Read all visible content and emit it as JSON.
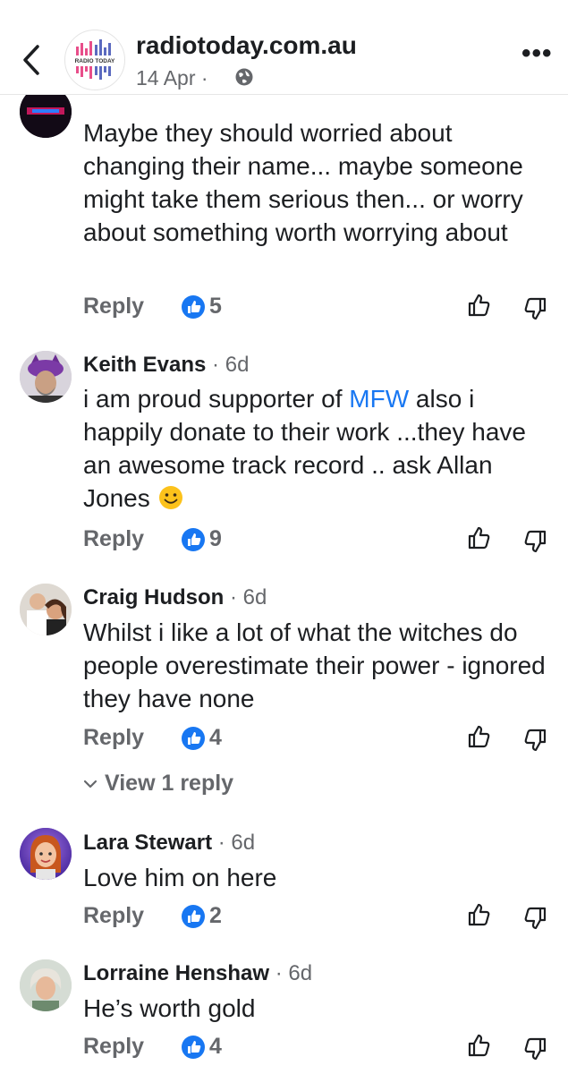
{
  "header": {
    "site_name": "radiotoday.com.au",
    "date": "14 Apr ·",
    "logo_text": "RADIO TODAY",
    "back_icon": "chevron-left-icon",
    "globe_icon": "globe-icon",
    "more_icon": "more-icon"
  },
  "comments": [
    {
      "text": "Maybe they should worried about changing their name... maybe someone might take them serious then... or worry about something worth worrying about",
      "reply_label": "Reply",
      "likes": "5"
    },
    {
      "name": "Keith Evans",
      "time": " · 6d",
      "text_before": "i am proud supporter of ",
      "text_link": "MFW",
      "text_after": " also i happily donate to their work ...they have an awesome track record .. ask Allan Jones ",
      "reply_label": "Reply",
      "likes": "9"
    },
    {
      "name": "Craig Hudson",
      "time": " · 6d",
      "text": "Whilst i like a lot of what the witches do people overestimate their power - ignored they have none",
      "reply_label": "Reply",
      "likes": "4",
      "view_replies": "View 1 reply"
    },
    {
      "name": "Lara Stewart",
      "time": " · 6d",
      "text": "Love him on here",
      "reply_label": "Reply",
      "likes": "2"
    },
    {
      "name": "Lorraine Henshaw",
      "time": " · 6d",
      "text": "He’s worth gold",
      "reply_label": "Reply",
      "likes": "4"
    }
  ],
  "colors": {
    "accent": "#1877f2",
    "secondary_text": "#65676b",
    "primary_text": "#1c1e21"
  }
}
